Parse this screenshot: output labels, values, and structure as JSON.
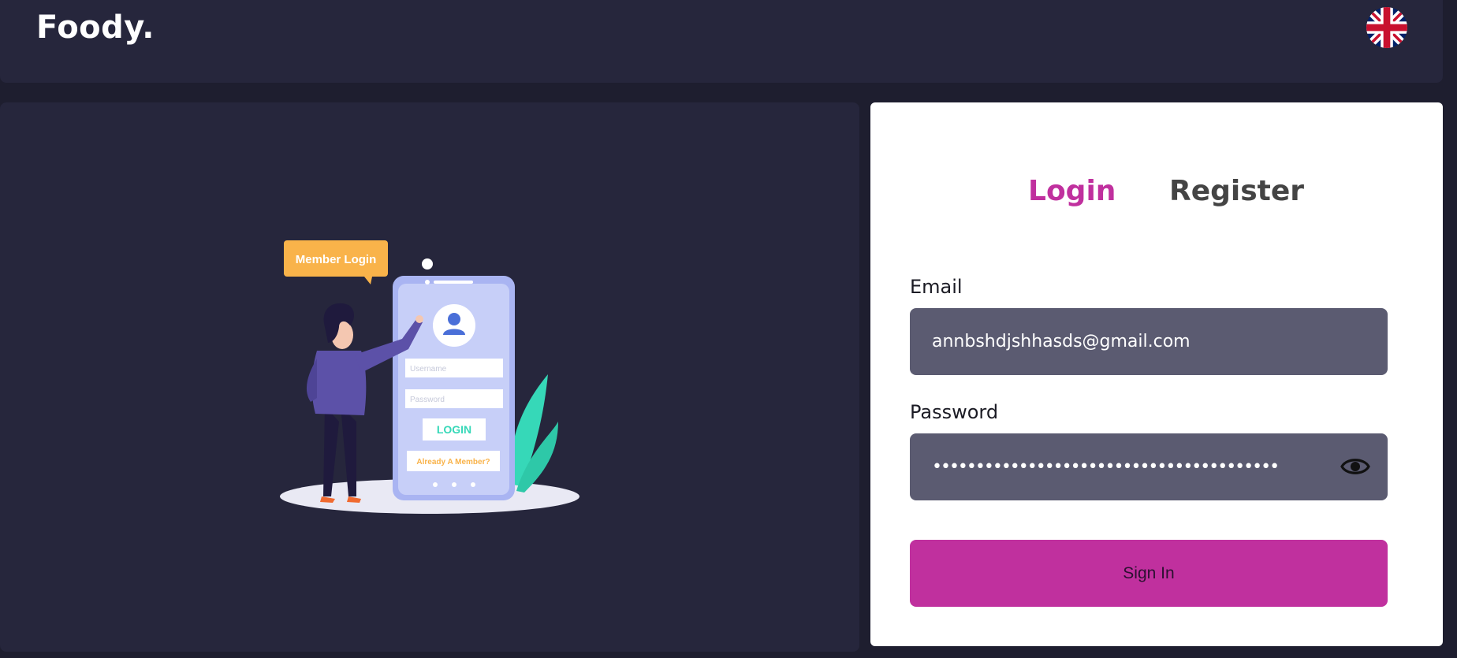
{
  "header": {
    "logo": "Foody.",
    "language_icon": "uk-flag-icon"
  },
  "illustration": {
    "bubble_text": "Member Login",
    "username_placeholder": "Username",
    "password_placeholder": "Password",
    "login_button": "LOGIN",
    "already_member": "Already A Member?"
  },
  "auth": {
    "tabs": {
      "login": "Login",
      "register": "Register"
    },
    "email": {
      "label": "Email",
      "value": "annbshdjshhasds@gmail.com"
    },
    "password": {
      "label": "Password",
      "masked_value": "••••••••••••••••••••••••••••••••••••••••",
      "toggle_icon": "eye-icon"
    },
    "signin_label": "Sign In"
  },
  "colors": {
    "accent": "#c0309e",
    "background": "#1e1e2f",
    "panel": "#26263c",
    "input": "#5b5b71"
  }
}
